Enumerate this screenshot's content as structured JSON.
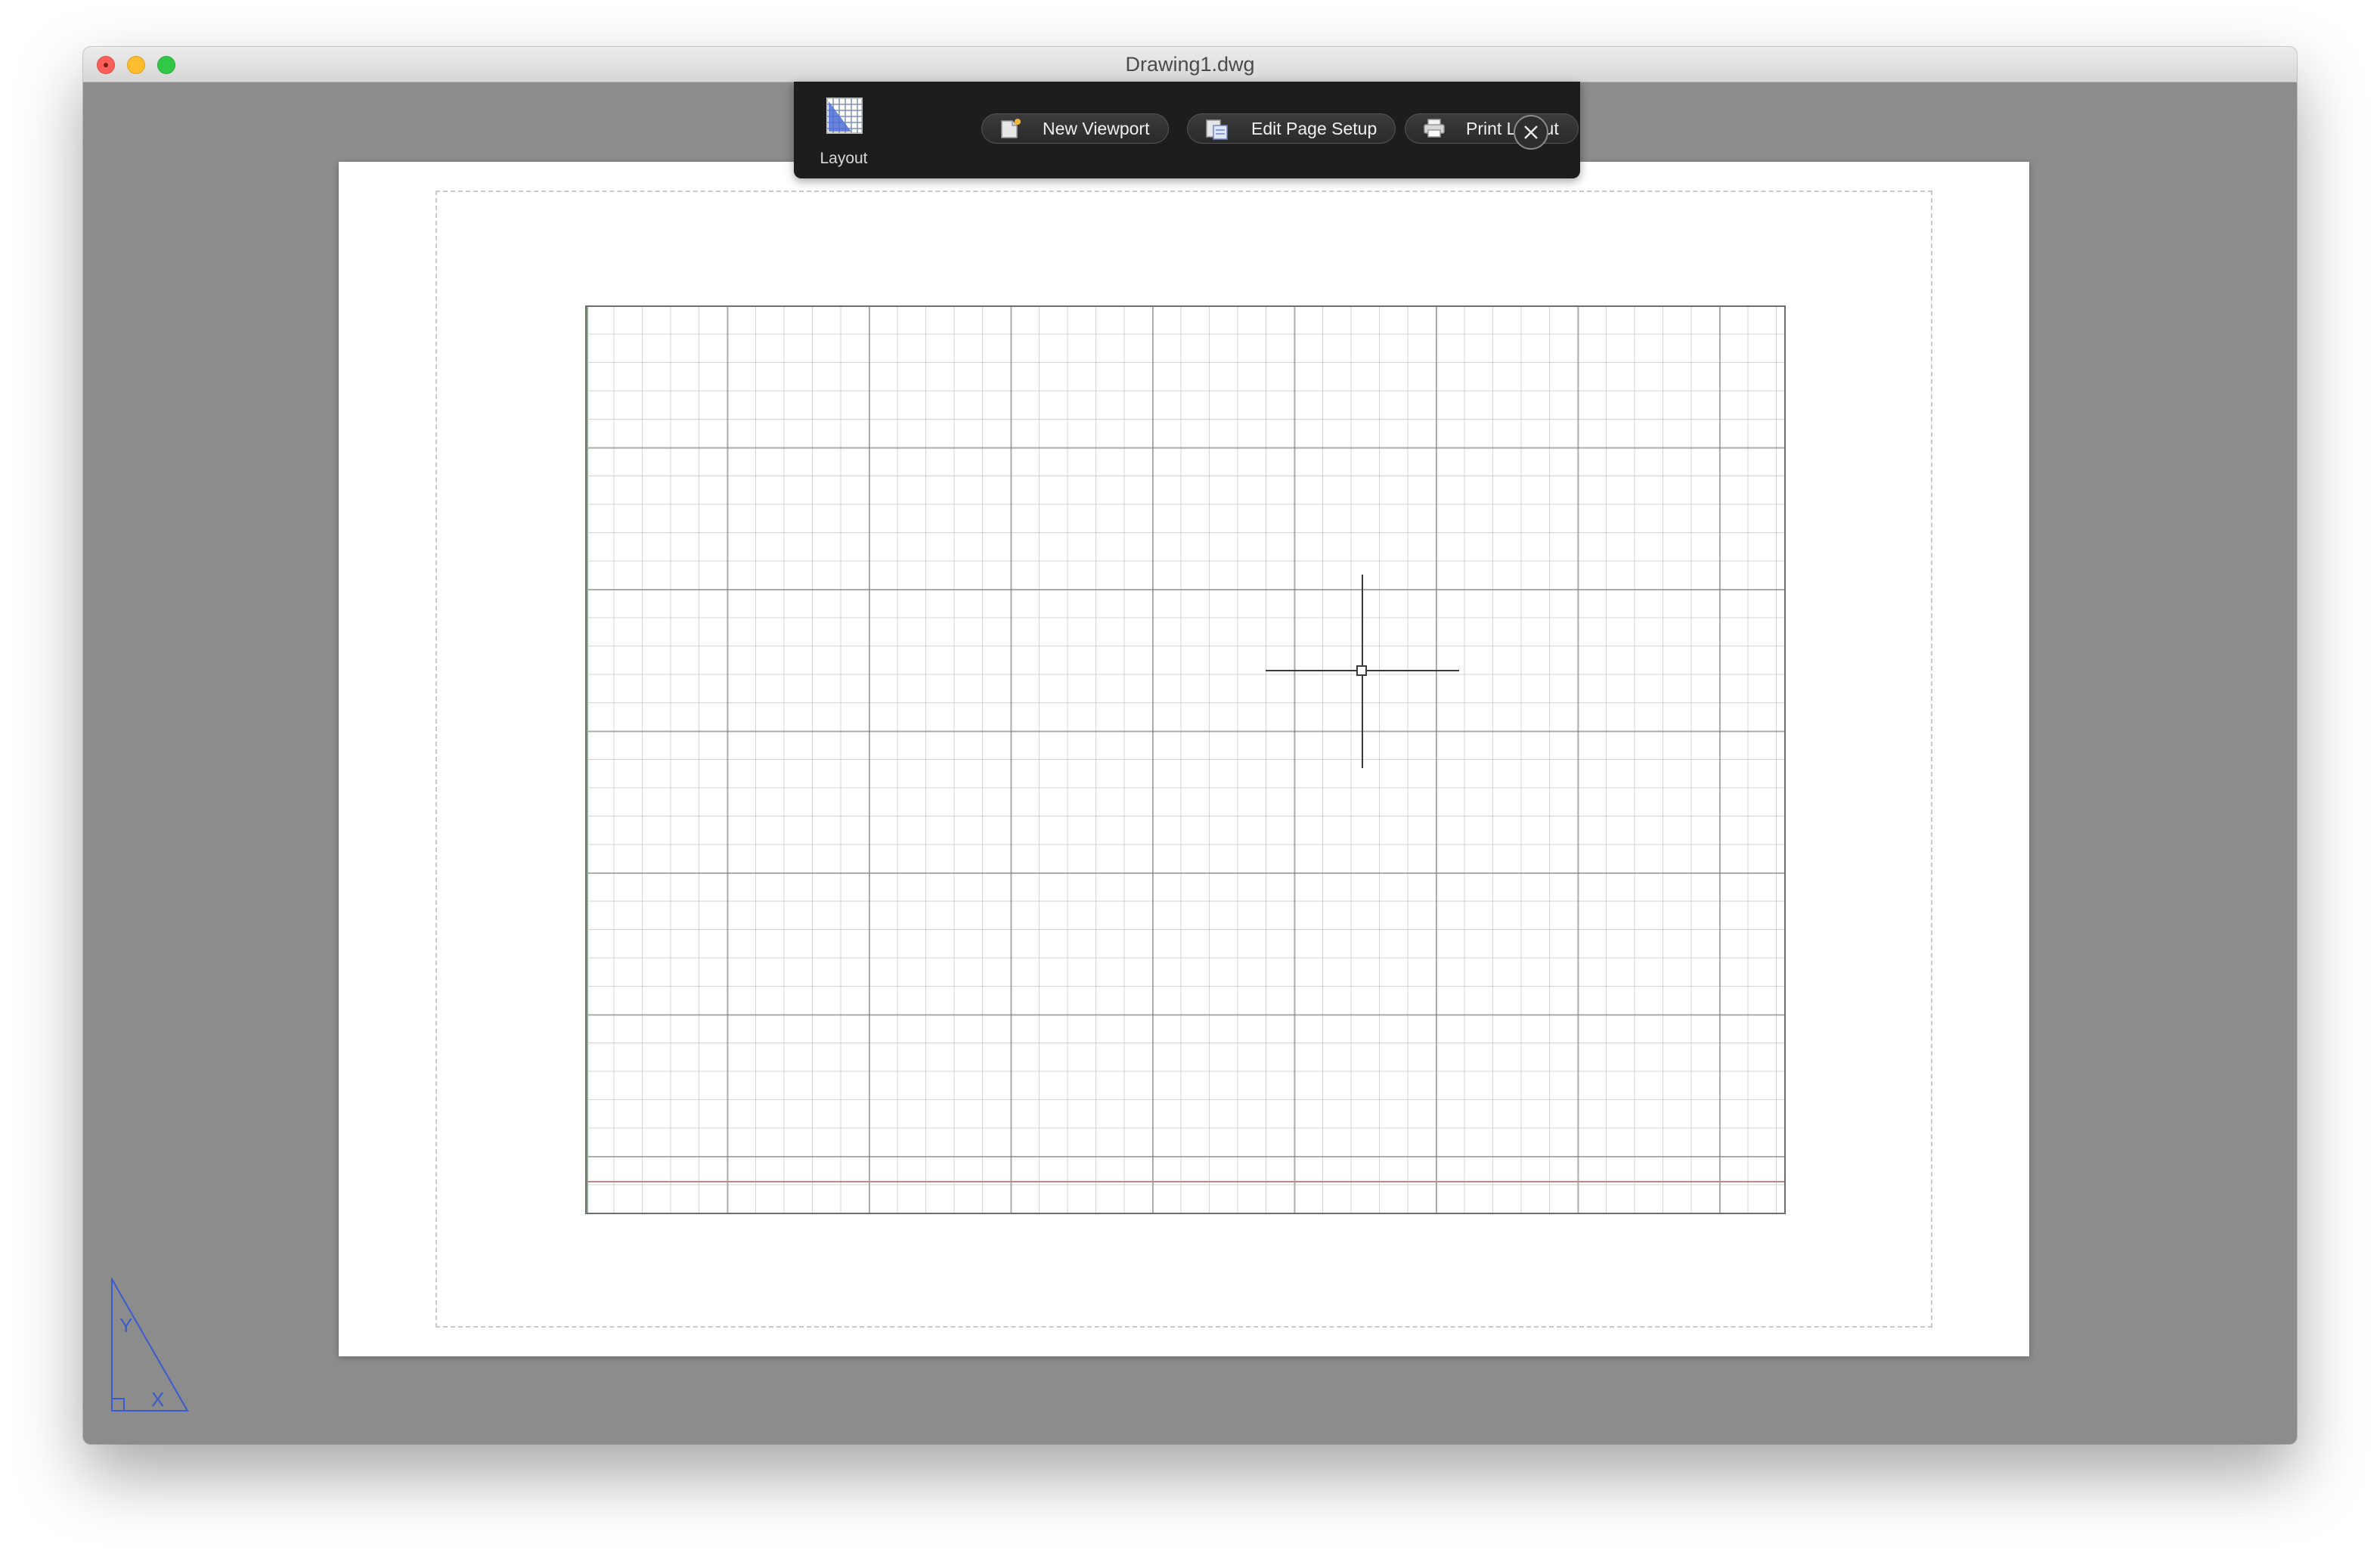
{
  "window": {
    "title": "Drawing1.dwg"
  },
  "toolbar": {
    "layout_label": "Layout",
    "layout_icon": "layout-icon",
    "buttons": [
      {
        "label": "New Viewport",
        "icon": "new-viewport-icon"
      },
      {
        "label": "Edit Page Setup",
        "icon": "page-setup-icon"
      },
      {
        "label": "Print Layout",
        "icon": "printer-icon"
      }
    ],
    "close_icon": "close-icon"
  },
  "canvas": {
    "ucs_icon": "ucs-triangle-icon",
    "ucs_labels": {
      "y": "Y",
      "x": "X"
    }
  },
  "colors": {
    "window_background": "#8c8c8c",
    "toolbar_background": "#1d1d1d",
    "ucs_icon": "#3a5bd0",
    "x_axis": "#b98a8a",
    "y_axis": "#8fae8f"
  }
}
